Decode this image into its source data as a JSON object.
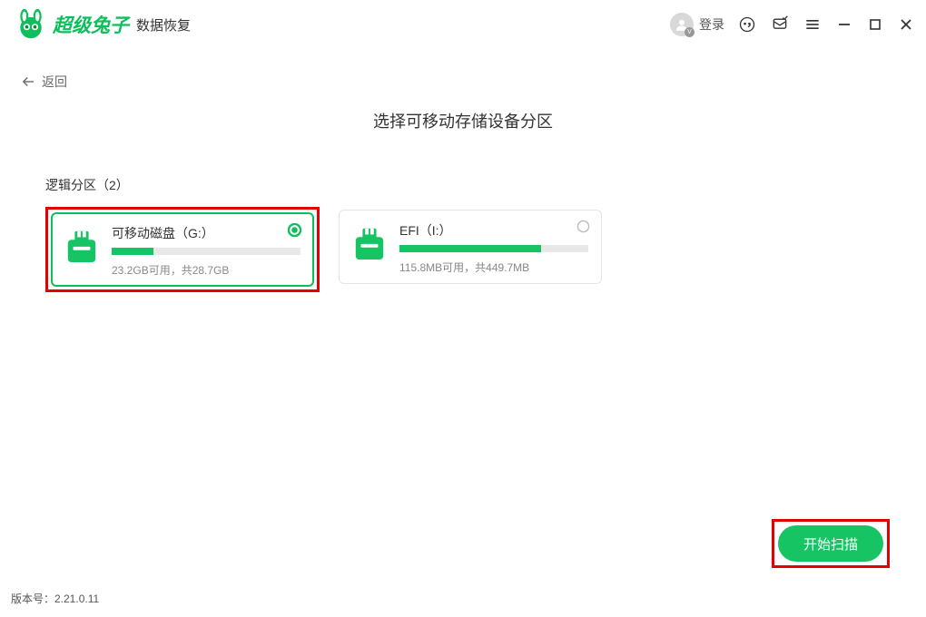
{
  "header": {
    "brand": "超级兔子",
    "brand_sub": "数据恢复",
    "login_label": "登录"
  },
  "back_label": "返回",
  "page_title": "选择可移动存储设备分区",
  "section_label": "逻辑分区（2）",
  "partitions": [
    {
      "title": "可移动磁盘（G:）",
      "sub": "23.2GB可用，共28.7GB",
      "fill_pct": 22,
      "selected": true,
      "highlighted": true
    },
    {
      "title": "EFI（I:）",
      "sub": "115.8MB可用，共449.7MB",
      "fill_pct": 75,
      "selected": false,
      "highlighted": false
    }
  ],
  "scan_button_label": "开始扫描",
  "version_label": "版本号：2.21.0.11"
}
